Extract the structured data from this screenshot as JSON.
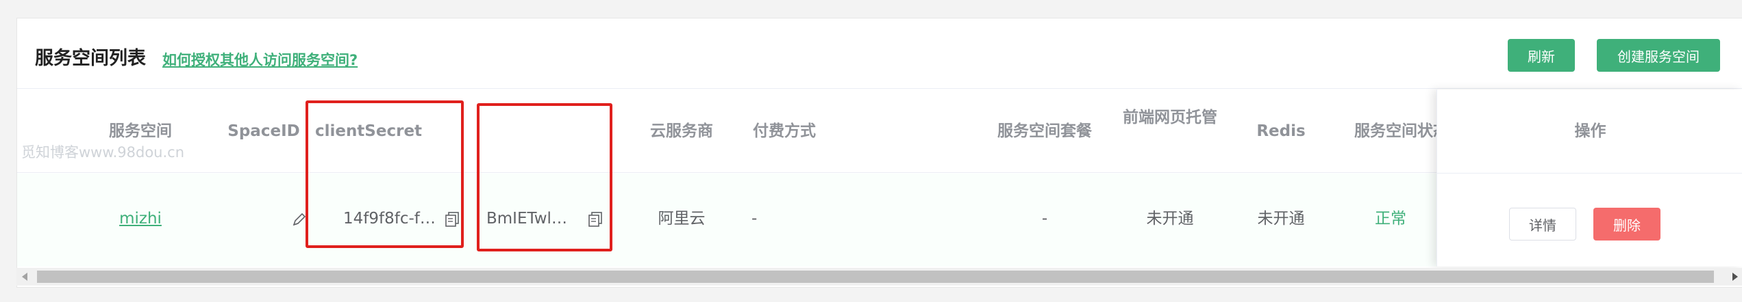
{
  "header": {
    "title": "服务空间列表",
    "help_link": "如何授权其他人访问服务空间?",
    "refresh_label": "刷新",
    "create_label": "创建服务空间"
  },
  "table": {
    "columns": {
      "space_name": "服务空间",
      "space_id": "SpaceID",
      "client_secret": "clientSecret",
      "cloud_provider": "云服务商",
      "payment": "付费方式",
      "package": "服务空间套餐",
      "frontend_hosting": "前端网页托管",
      "redis": "Redis",
      "status": "服务空间状态",
      "actions": "操作"
    },
    "rows": [
      {
        "space_name": "mizhi",
        "space_id": "14f9f8fc-f…",
        "client_secret": "BmIETwl…",
        "cloud_provider": "阿里云",
        "payment": "-",
        "package": "-",
        "frontend_hosting": "未开通",
        "redis": "未开通",
        "status": "正常",
        "detail_label": "详情",
        "delete_label": "删除"
      }
    ]
  },
  "watermark": "觅知博客www.98dou.cn",
  "colors": {
    "accent": "#3fb07a",
    "danger": "#f56c6c",
    "highlight_box": "#e0201d"
  },
  "icons": {
    "copy": "copy-icon",
    "edit": "edit-icon"
  }
}
